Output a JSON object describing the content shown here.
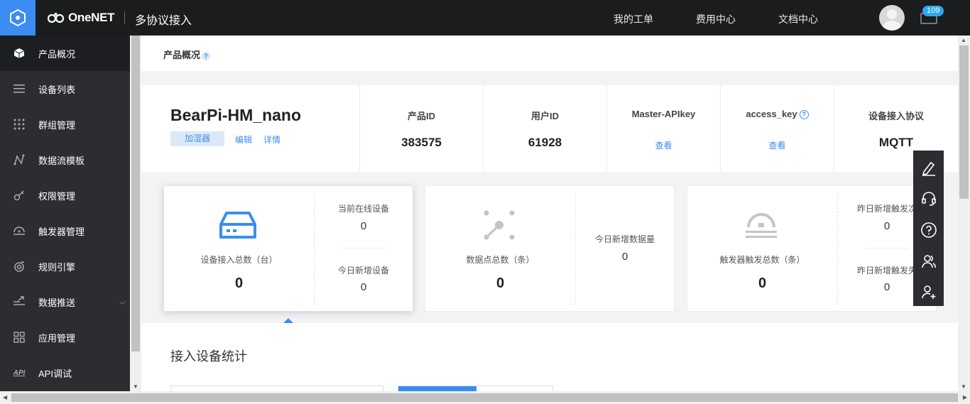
{
  "header": {
    "brand": "OneNET",
    "product_line": "多协议接入",
    "nav": [
      "我的工单",
      "费用中心",
      "文档中心"
    ],
    "message_count": "109"
  },
  "sidebar": {
    "items": [
      {
        "label": "产品概况",
        "icon": "cube-icon"
      },
      {
        "label": "设备列表",
        "icon": "list-icon"
      },
      {
        "label": "群组管理",
        "icon": "grid-dots-icon"
      },
      {
        "label": "数据流模板",
        "icon": "graph-line-icon"
      },
      {
        "label": "权限管理",
        "icon": "key-icon"
      },
      {
        "label": "触发器管理",
        "icon": "trigger-icon"
      },
      {
        "label": "规则引擎",
        "icon": "engine-icon"
      },
      {
        "label": "数据推送",
        "icon": "push-icon"
      },
      {
        "label": "应用管理",
        "icon": "apps-icon"
      },
      {
        "label": "API调试",
        "icon": "api-icon"
      }
    ]
  },
  "page": {
    "breadcrumb": "产品概况",
    "product": {
      "name": "BearPi-HM_nano",
      "tag": "加湿器",
      "edit": "编辑",
      "detail": "详情"
    },
    "info_columns": [
      {
        "title": "产品ID",
        "value": "383575"
      },
      {
        "title": "用户ID",
        "value": "61928"
      },
      {
        "title": "Master-APIkey",
        "link": "查看"
      },
      {
        "title": "access_key",
        "link": "查看"
      },
      {
        "title": "设备接入协议",
        "value": "MQTT"
      }
    ],
    "stats": [
      {
        "label": "设备接入总数（台）",
        "value": "0",
        "sub": [
          {
            "label": "当前在线设备",
            "value": "0"
          },
          {
            "label": "今日新增设备",
            "value": "0"
          }
        ]
      },
      {
        "label": "数据点总数（条）",
        "value": "0",
        "sub": [
          {
            "label": "今日新增数据量",
            "value": "0"
          }
        ]
      },
      {
        "label": "触发器触发总数（条）",
        "value": "0",
        "sub": [
          {
            "label": "昨日新增触发次",
            "value": "0"
          },
          {
            "label": "昨日新增触发失",
            "value": "0"
          }
        ]
      }
    ],
    "section_title": "接入设备统计"
  },
  "colors": {
    "accent": "#3b8df2",
    "topbar": "#1b1c1e",
    "sidebar": "#2b2d31"
  }
}
